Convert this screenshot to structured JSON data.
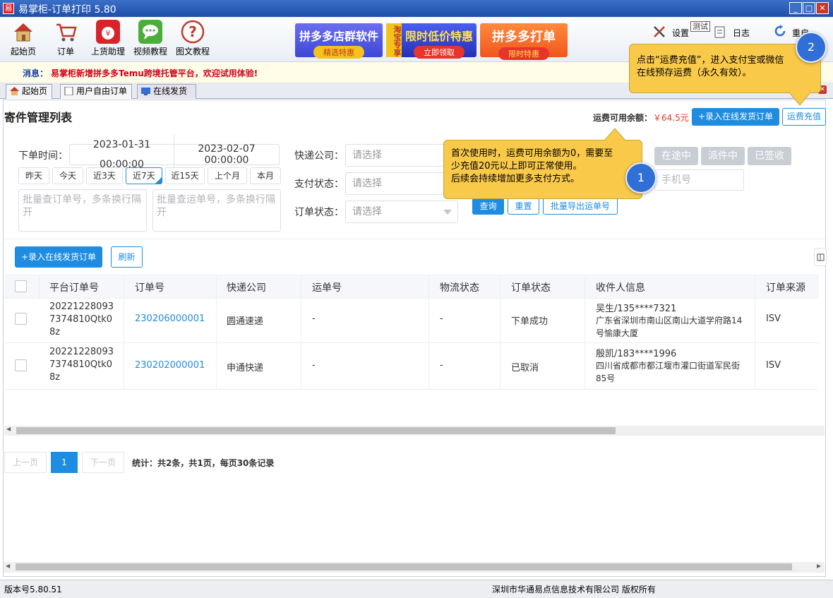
{
  "window": {
    "app_icon": "易",
    "title": "易掌柜-订单打印 5.80",
    "min": "_",
    "max": "□",
    "close": "✕"
  },
  "toolbar": {
    "home": "起始页",
    "orders": "订单",
    "assistant": "上货助理",
    "video": "视频教程",
    "tutorial": "图文教程",
    "settings": "设置",
    "test_badge": "测试",
    "log": "日志",
    "restart": "重启"
  },
  "ads": [
    {
      "big": "拼多多店群软件",
      "pill": "精选特惠"
    },
    {
      "side": "淘宝专享",
      "big": "限时低价特惠",
      "pill": "立即领取"
    },
    {
      "big": "拼多多打单",
      "pill": "限时特惠"
    }
  ],
  "message": {
    "label": "消息：",
    "text": "易掌柜新增拼多多Temu跨境托管平台，欢迎试用体验!"
  },
  "tabs": [
    "起始页",
    "用户自由订单",
    "在线发货"
  ],
  "page": {
    "title": "寄件管理列表",
    "balance_label": "运费可用余额：",
    "balance_value": "￥64.5元",
    "add_online_order": "+录入在线发货订单",
    "recharge": "运费充值"
  },
  "filters": {
    "order_time_label": "下单时间：",
    "start_time": "2023-01-31 00:00:00",
    "end_time": "2023-02-07 00:00:00",
    "quick_ranges": [
      "昨天",
      "今天",
      "近3天",
      "近7天",
      "近15天",
      "上个月",
      "本月"
    ],
    "batch_order_placeholder": "批量查订单号，多条换行隔开",
    "batch_waybill_placeholder": "批量查运单号，多条换行隔开",
    "courier_label": "快递公司：",
    "pay_status_label": "支付状态：",
    "order_status_label": "订单状态：",
    "select_placeholder": "请选择",
    "status_buttons": [
      "在途中",
      "派件中",
      "已签收"
    ],
    "phone_placeholder": "手机号",
    "query": "查询",
    "reset": "重置",
    "batch_export": "批量导出运单号"
  },
  "list_actions": {
    "add": "+录入在线发货订单",
    "refresh": "刷新"
  },
  "table": {
    "headers": [
      "平台订单号",
      "订单号",
      "快递公司",
      "运单号",
      "物流状态",
      "订单状态",
      "收件人信息",
      "订单来源"
    ],
    "rows": [
      {
        "platform_no": [
          "20221228093",
          "7374810Qtk0",
          "8z"
        ],
        "order_no": "230206000001",
        "courier": "圆通速递",
        "waybill": "-",
        "logistics": "-",
        "status": "下单成功",
        "receiver": "吴生/135****7321",
        "address": [
          "广东省深圳市南山区南山大道学府路14",
          "号愉康大厦"
        ],
        "source": "ISV"
      },
      {
        "platform_no": [
          "20221228093",
          "7374810Qtk0",
          "8z"
        ],
        "order_no": "230202000001",
        "courier": "申通快递",
        "waybill": "-",
        "logistics": "-",
        "status": "已取消",
        "receiver": "殷凯/183****1996",
        "address": [
          "四川省成都市都江堰市灌口街道军民街",
          "85号"
        ],
        "source": "ISV"
      }
    ]
  },
  "pagination": {
    "prev": "上一页",
    "current": "1",
    "next": "下一页",
    "summary": "统计：共2条，共1页，每页30条记录"
  },
  "tooltips": {
    "step1": {
      "number": "1",
      "lines": [
        "首次使用时，运费可用余额为0，需要至",
        "少充值20元以上即可正常使用。",
        "后续会持续增加更多支付方式。"
      ]
    },
    "step2": {
      "number": "2",
      "lines": [
        "点击“运费充值”，进入支付宝或微信",
        "在线预存运费（永久有效）。"
      ]
    }
  },
  "statusbar": {
    "version": "版本号5.80.51",
    "copyright": "深圳市华通易点信息技术有限公司 版权所有"
  },
  "colors": {
    "accent": "#1e8ce0",
    "tooltip": "#f9c94a",
    "badge": "#2f6fd6",
    "balance": "#e6352b"
  }
}
